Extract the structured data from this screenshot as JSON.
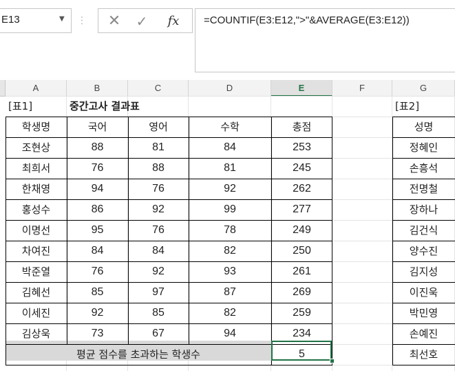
{
  "name_box": {
    "value": "E13"
  },
  "formula_bar": {
    "separator": "⋮",
    "cancel_glyph": "✕",
    "enter_glyph": "✓",
    "fx_label": "fx",
    "formula": "=COUNTIF(E3:E12,\">\"&AVERAGE(E3:E12))"
  },
  "columns": [
    "A",
    "B",
    "C",
    "D",
    "E",
    "F",
    "G"
  ],
  "selected_column": "E",
  "table1": {
    "tag": "[표1]",
    "title": "중간고사 결과표",
    "headers": [
      "학생명",
      "국어",
      "영어",
      "수학",
      "총점"
    ],
    "rows": [
      [
        "조현상",
        "88",
        "81",
        "84",
        "253"
      ],
      [
        "최희서",
        "76",
        "88",
        "81",
        "245"
      ],
      [
        "한채영",
        "94",
        "76",
        "92",
        "262"
      ],
      [
        "홍성수",
        "86",
        "92",
        "99",
        "277"
      ],
      [
        "이명선",
        "95",
        "76",
        "78",
        "249"
      ],
      [
        "차여진",
        "84",
        "84",
        "82",
        "250"
      ],
      [
        "박준열",
        "76",
        "92",
        "93",
        "261"
      ],
      [
        "김혜선",
        "85",
        "97",
        "87",
        "269"
      ],
      [
        "이세진",
        "92",
        "85",
        "82",
        "259"
      ],
      [
        "김상욱",
        "73",
        "67",
        "94",
        "234"
      ]
    ],
    "summary_label": "평균 점수를 초과하는 학생수",
    "summary_value": "5"
  },
  "table2": {
    "tag": "[표2]",
    "header": "성명",
    "names": [
      "정혜인",
      "손흥석",
      "전명철",
      "장하나",
      "김건식",
      "양수진",
      "김지성",
      "이진욱",
      "박민영",
      "손예진",
      "최선호"
    ]
  }
}
